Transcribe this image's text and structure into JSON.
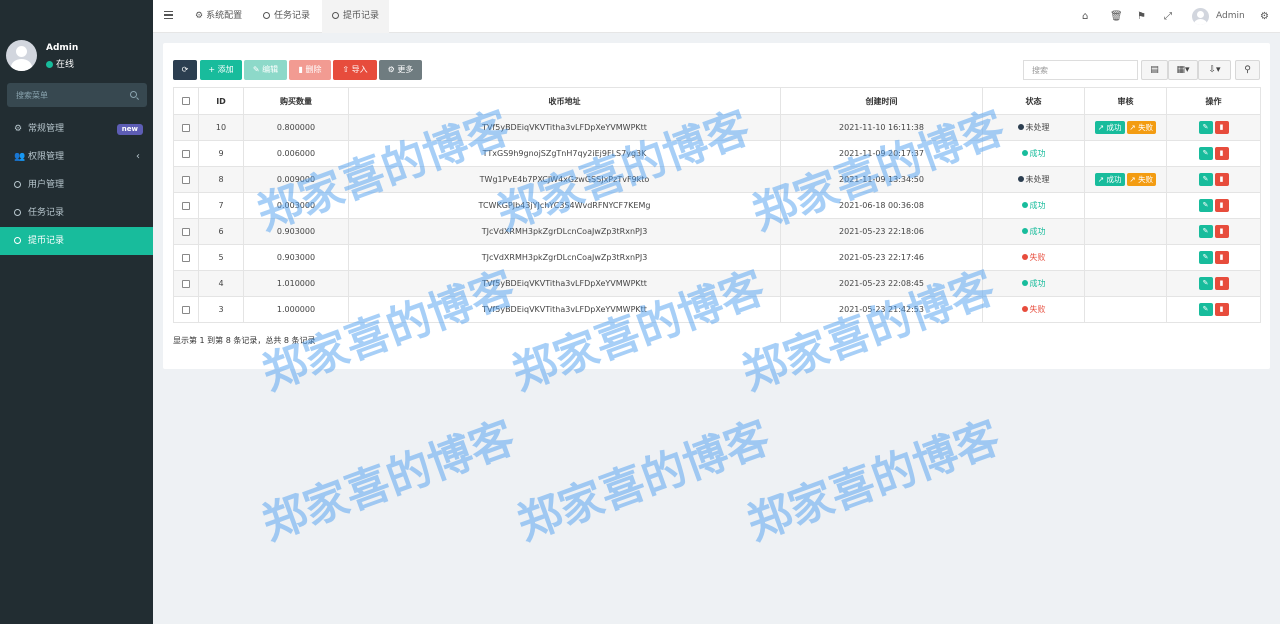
{
  "sidebar": {
    "user_name": "Admin",
    "user_status": "在线",
    "search_placeholder": "搜索菜单",
    "items": [
      {
        "label": "常规管理",
        "badge": "new"
      },
      {
        "label": "权限管理",
        "chevron": "‹"
      },
      {
        "label": "用户管理"
      },
      {
        "label": "任务记录"
      },
      {
        "label": "提币记录"
      }
    ]
  },
  "header": {
    "tabs": [
      {
        "label": "系统配置"
      },
      {
        "label": "任务记录"
      },
      {
        "label": "提币记录"
      }
    ],
    "user": "Admin"
  },
  "toolbar": {
    "add": "添加",
    "edit": "编辑",
    "delete": "删除",
    "import": "导入",
    "more": "更多",
    "search_placeholder": "搜索"
  },
  "table": {
    "columns": [
      "ID",
      "购买数量",
      "收币地址",
      "创建时间",
      "状态",
      "审核",
      "操作"
    ],
    "rows": [
      {
        "id": "10",
        "amount": "0.800000",
        "address": "TVf5yBDEiqVKVTitha3vLFDpXeYVMWPKtt",
        "time": "2021-11-10 16:11:38",
        "status": "未处理",
        "status_type": "pending",
        "audit": true
      },
      {
        "id": "9",
        "amount": "0.006000",
        "address": "TTxGS9h9gnojSZgTnH7qy2iEj9FLS7yg3K",
        "time": "2021-11-09 20:17:37",
        "status": "成功",
        "status_type": "success",
        "audit": false
      },
      {
        "id": "8",
        "amount": "0.009000",
        "address": "TWg1PvE4b7PXCJW4xGzwGSSJxPzTvF9kto",
        "time": "2021-11-09 13:34:50",
        "status": "未处理",
        "status_type": "pending",
        "audit": true
      },
      {
        "id": "7",
        "amount": "0.003000",
        "address": "TCWKGPJb43jYJchYC3S4WvdRFNYCF7KEMg",
        "time": "2021-06-18 00:36:08",
        "status": "成功",
        "status_type": "success",
        "audit": false
      },
      {
        "id": "6",
        "amount": "0.903000",
        "address": "TJcVdXRMH3pkZgrDLcnCoaJwZp3tRxnPJ3",
        "time": "2021-05-23 22:18:06",
        "status": "成功",
        "status_type": "success",
        "audit": false
      },
      {
        "id": "5",
        "amount": "0.903000",
        "address": "TJcVdXRMH3pkZgrDLcnCoaJwZp3tRxnPJ3",
        "time": "2021-05-23 22:17:46",
        "status": "失败",
        "status_type": "fail",
        "audit": false
      },
      {
        "id": "4",
        "amount": "1.010000",
        "address": "TVf5yBDEiqVKVTitha3vLFDpXeYVMWPKtt",
        "time": "2021-05-23 22:08:45",
        "status": "成功",
        "status_type": "success",
        "audit": false
      },
      {
        "id": "3",
        "amount": "1.000000",
        "address": "TVf5yBDEiqVKVTitha3vLFDpXeYVMWPKtt",
        "time": "2021-05-23 21:42:53",
        "status": "失败",
        "status_type": "fail",
        "audit": false
      }
    ],
    "audit_success": "成功",
    "audit_fail": "失败"
  },
  "footer": "显示第 1 到第 8 条记录，总共 8 条记录",
  "watermark": "郑家喜的博客",
  "colors": {
    "sidebar_bg": "#222d32",
    "accent": "#18bc9c",
    "danger": "#e74c3c",
    "warning": "#f39c12",
    "dark": "#2c3e50"
  }
}
